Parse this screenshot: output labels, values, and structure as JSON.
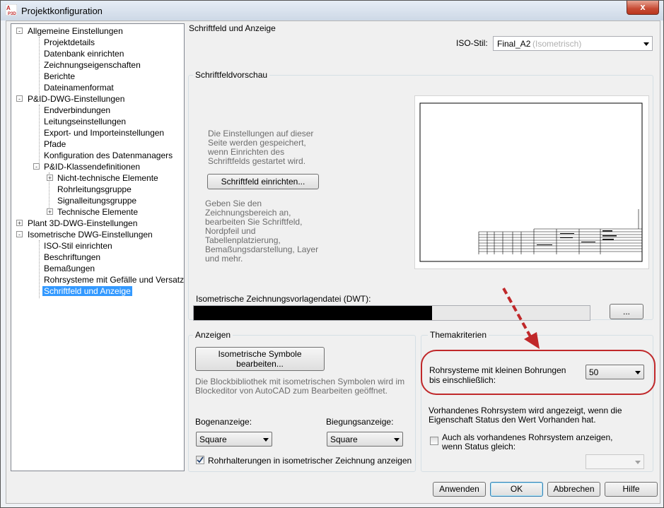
{
  "window": {
    "title": "Projektkonfiguration",
    "close": "x"
  },
  "tree": {
    "items": [
      {
        "label": "Allgemeine Einstellungen",
        "level": 0,
        "expander": "-"
      },
      {
        "label": "Projektdetails",
        "level": 1
      },
      {
        "label": "Datenbank einrichten",
        "level": 1
      },
      {
        "label": "Zeichnungseigenschaften",
        "level": 1
      },
      {
        "label": "Berichte",
        "level": 1
      },
      {
        "label": "Dateinamenformat",
        "level": 1
      },
      {
        "label": "P&ID-DWG-Einstellungen",
        "level": 0,
        "expander": "-"
      },
      {
        "label": "Endverbindungen",
        "level": 1
      },
      {
        "label": "Leitungseinstellungen",
        "level": 1
      },
      {
        "label": "Export- und Importeinstellungen",
        "level": 1
      },
      {
        "label": "Pfade",
        "level": 1
      },
      {
        "label": "Konfiguration des Datenmanagers",
        "level": 1
      },
      {
        "label": "P&ID-Klassendefinitionen",
        "level": 1,
        "expander": "-"
      },
      {
        "label": "Nicht-technische Elemente",
        "level": 2,
        "expander": "+"
      },
      {
        "label": "Rohrleitungsgruppe",
        "level": 2
      },
      {
        "label": "Signalleitungsgruppe",
        "level": 2
      },
      {
        "label": "Technische Elemente",
        "level": 2,
        "expander": "+"
      },
      {
        "label": "Plant 3D-DWG-Einstellungen",
        "level": 0,
        "expander": "+"
      },
      {
        "label": "Isometrische DWG-Einstellungen",
        "level": 0,
        "expander": "-"
      },
      {
        "label": "ISO-Stil einrichten",
        "level": 1
      },
      {
        "label": "Beschriftungen",
        "level": 1
      },
      {
        "label": "Bemaßungen",
        "level": 1
      },
      {
        "label": "Rohrsysteme mit Gefälle und Versatz",
        "level": 1
      },
      {
        "label": "Schriftfeld und Anzeige",
        "level": 1,
        "selected": true
      }
    ]
  },
  "main": {
    "section_title": "Schriftfeld und Anzeige",
    "iso_style_label": "ISO-Stil:",
    "iso_style_value": "Final_A2",
    "iso_style_suffix": "(Isometrisch)",
    "preview_group": "Schriftfeldvorschau",
    "preview_info1": "Die Einstellungen auf dieser Seite werden gespeichert, wenn Einrichten des Schriftfelds gestartet wird.",
    "setup_button": "Schriftfeld einrichten...",
    "preview_info2": "Geben Sie den Zeichnungsbereich an, bearbeiten Sie Schriftfeld, Nordpfeil und Tabellenplatzierung, Bemaßungsdarstellung, Layer und mehr.",
    "dwt_label": "Isometrische Zeichnungsvorlagendatei (DWT):",
    "browse_button": "...",
    "display_group": "Anzeigen",
    "iso_symbols_button_line1": "Isometrische Symbole",
    "iso_symbols_button_line2": "bearbeiten...",
    "block_info": "Die Blockbibliothek mit isometrischen Symbolen wird im Blockeditor von AutoCAD zum Bearbeiten geöffnet.",
    "arc_label": "Bogenanzeige:",
    "arc_value": "Square",
    "bend_label": "Biegungsanzeige:",
    "bend_value": "Square",
    "supports_checkbox": "Rohrhalterungen in isometrischer Zeichnung anzeigen",
    "theme_group": "Themakriterien",
    "small_bore_label": "Rohrsysteme mit kleinen Bohrungen bis einschließlich:",
    "small_bore_value": "50",
    "existing_info": "Vorhandenes Rohrsystem wird angezeigt, wenn die Eigenschaft Status den Wert Vorhanden hat.",
    "also_existing_checkbox": "Auch als vorhandenes Rohrsystem anzeigen, wenn Status gleich:",
    "status_value": ""
  },
  "footer": {
    "apply": "Anwenden",
    "ok": "OK",
    "cancel": "Abbrechen",
    "help": "Hilfe"
  },
  "colors": {
    "selection": "#3399ff",
    "highlight": "#c0282a"
  },
  "icons": {
    "app": "autocad-p3d-icon",
    "annotation": "red-dashed-arrow"
  }
}
